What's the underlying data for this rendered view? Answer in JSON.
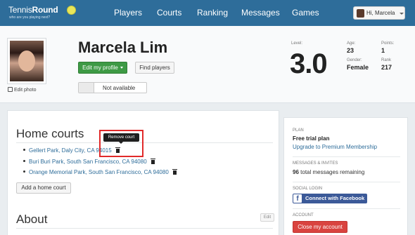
{
  "navbar": {
    "logo_text_a": "Tennis",
    "logo_text_b": "Round",
    "logo_tagline": "who are you playing next?",
    "items": [
      "Players",
      "Courts",
      "Ranking",
      "Messages",
      "Games"
    ],
    "user_label": "Hi, Marcela",
    "brand_color": "#2e6d9a"
  },
  "profile": {
    "edit_photo": "Edit photo",
    "name": "Marcela Lim",
    "edit_profile_btn": "Edit my profile",
    "find_players_btn": "Find players",
    "availability": "Not available",
    "level_label": "Level:",
    "level_value": "3.0",
    "age_label": "Age:",
    "age_value": "23",
    "points_label": "Points:",
    "points_value": "1",
    "gender_label": "Gender:",
    "gender_value": "Female",
    "rank_label": "Rank",
    "rank_value": "217"
  },
  "home_courts": {
    "title": "Home courts",
    "courts": [
      "Gellert Park, Daly City, CA 94015",
      "Buri Buri Park, South San Francisco, CA 94080",
      "Orange Memorial Park, South San Francisco, CA 94080"
    ],
    "add_btn": "Add a home court",
    "tooltip": "Remove court",
    "highlight_color": "#e12a2a"
  },
  "about": {
    "title": "About",
    "edit_btn": "Edit"
  },
  "sidebar": {
    "plan_label": "PLAN",
    "plan_value": "Free trial plan",
    "upgrade_link": "Upgrade to Premium Membership",
    "messages_label": "MESSAGES & INVITES",
    "messages_count": "96",
    "messages_text": "total messages remaining",
    "social_label": "SOCIAL LOGIN",
    "facebook_btn": "Connect with Facebook",
    "account_label": "ACCOUNT",
    "close_btn": "Close my account"
  }
}
